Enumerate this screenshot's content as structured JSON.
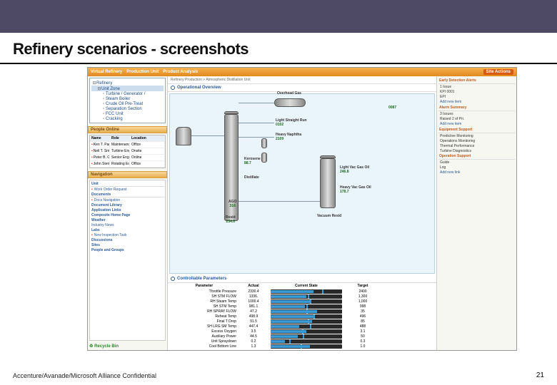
{
  "slide": {
    "title": "Refinery scenarios - screenshots",
    "footer": "Accenture/Avanade/Microsoft Alliance Confidential",
    "pagenum": "21"
  },
  "app": {
    "header": {
      "tab1": "Virtual Refinery",
      "tab2": "Production Unit",
      "tab3": "Product Analysis",
      "right": "Site Actions"
    },
    "breadcrumb": "Refinery Production > Atmospheric Distillation Unit",
    "tree": {
      "root": "Refinery",
      "node1": "Unit Zone",
      "items": [
        "Turbine / Generator /",
        "Steam Boiler",
        "Crude Oil Pre-Treat",
        "Separation Section",
        "FCC Unit",
        "Cracking"
      ]
    },
    "people_section": "People Online",
    "people_headers": [
      "Name",
      "Role",
      "Location"
    ],
    "people": [
      {
        "name": "Ken T. Parker",
        "role": "Maintenance Manager",
        "loc": "Office"
      },
      {
        "name": "Neil T. Small",
        "role": "Turbine Engineer",
        "loc": "Onsite"
      },
      {
        "name": "Peter B. Gould",
        "role": "Senior Engineer",
        "loc": "Online"
      },
      {
        "name": "John Steinhoff",
        "role": "Rotating Equipment",
        "loc": "Office"
      }
    ],
    "nav_head": "Navigation",
    "links": {
      "unit_head": "Unit",
      "unit_item": "Work Order Request",
      "docs_head": "Documents",
      "docs_item": "Docs Navigation",
      "items": [
        "Document Library",
        "Application Links",
        "Composite Home Page",
        "Weather",
        "Industry News",
        "Labs"
      ],
      "labs_item": "New Inspection Task",
      "tail": [
        "Discussions",
        "Sites",
        "People and Groups"
      ],
      "recycle": "Recycle Bin"
    },
    "overview_title": "Operational Overview",
    "diagram": {
      "overhead": {
        "label": "Overhead Gas",
        "val": "0087"
      },
      "lsr": {
        "label": "Light Straight Run",
        "val": "0102"
      },
      "naphtha": {
        "label": "Heavy Naphtha",
        "val": "2109"
      },
      "kerosene": {
        "label": "Kerosene",
        "val": "88.7"
      },
      "distillate": {
        "label": "Distillate",
        "val": ""
      },
      "gasoil_top": {
        "label": "Light Vac Gas Oil",
        "val": "246.8"
      },
      "gasoil_bot": {
        "label": "Heavy Vac Gas Oil",
        "val": "178.7"
      },
      "ago": {
        "label": "AGO",
        "val": "316"
      },
      "resid": {
        "label": "Resid",
        "val": "234.6"
      },
      "vacresid": {
        "label": "Vacuum Resid",
        "val": ""
      }
    },
    "params_title": "Controllable Parameters",
    "param_headers": [
      "Parameter",
      "Actual",
      "Current State",
      "Target"
    ],
    "params": [
      {
        "name": "Throttle Pressure",
        "actual": "2330.4",
        "target": "2400",
        "pct": 60,
        "tpct": 72
      },
      {
        "name": "SH STM FLOW",
        "actual": "1336.",
        "target": "1,300",
        "pct": 50,
        "tpct": 52
      },
      {
        "name": "RH Steam Temp",
        "actual": "1000.4",
        "target": "1,000",
        "pct": 55,
        "tpct": 55
      },
      {
        "name": "SH STM Temp",
        "actual": "981.1",
        "target": "998",
        "pct": 48,
        "tpct": 50
      },
      {
        "name": "RH SPRAY FLOW",
        "actual": "47.2",
        "target": "35",
        "pct": 65,
        "tpct": 50
      },
      {
        "name": "Reheat Temp",
        "actual": "498.9",
        "target": "496",
        "pct": 62,
        "tpct": 60
      },
      {
        "name": "Final T Drop",
        "actual": "91.5",
        "target": "85",
        "pct": 58,
        "tpct": 52
      },
      {
        "name": "SH LRG SM Temp",
        "actual": "447.4",
        "target": "488",
        "pct": 40,
        "tpct": 55
      },
      {
        "name": "Excess Oxygen",
        "actual": "3.5",
        "target": "3.1",
        "pct": 50,
        "tpct": 44
      },
      {
        "name": "Auxiliary Power",
        "actual": "44.5",
        "target": "50",
        "pct": 38,
        "tpct": 45
      },
      {
        "name": "Unit Spraydown",
        "actual": "0.2",
        "target": "0.3",
        "pct": 20,
        "tpct": 26
      },
      {
        "name": "Cool Bottom Line",
        "actual": "1.3",
        "target": "1.0",
        "pct": 55,
        "tpct": 42
      }
    ],
    "right": {
      "alerts_head": "Early Detection Alerts",
      "alerts": [
        "1 Issue",
        "KPI 0001",
        "EPI"
      ],
      "alerts_link": "Add new item",
      "summary_head": "Alarm Summary",
      "summary": [
        "3 Issues",
        "Raised 2 of Pri."
      ],
      "summary_link": "Add new item",
      "equip_head": "Equipment Support",
      "equip": [
        "Predictive Monitoring",
        "Operations Monitoring",
        "Thermal Performance",
        "Turbine Diagnostics"
      ],
      "ops_head": "Operation Support",
      "ops": [
        "Guide",
        "Log"
      ],
      "ops_link": "Add new link"
    }
  }
}
